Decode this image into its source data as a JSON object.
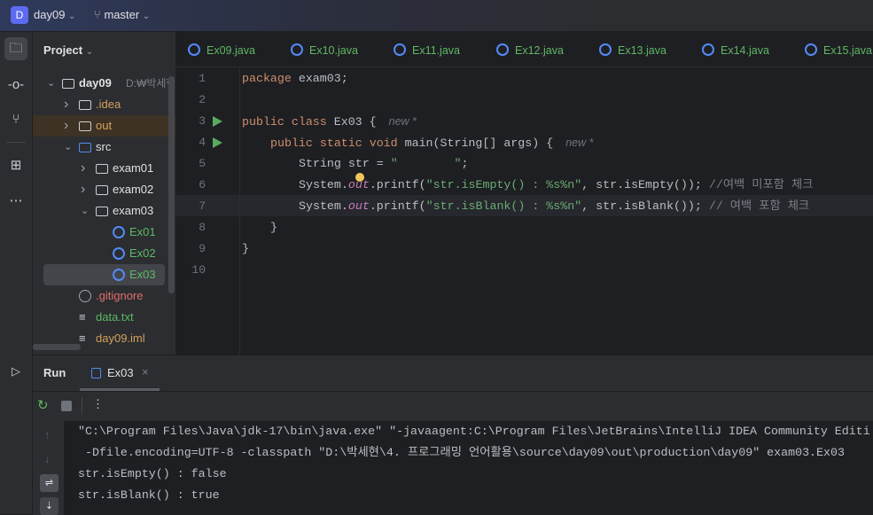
{
  "topbar": {
    "project_badge": "D",
    "project": "day09",
    "branch": "master"
  },
  "project_panel": {
    "title": "Project",
    "tree": [
      {
        "label": "day09",
        "path": "D:₩박세현",
        "kind": "module"
      },
      {
        "label": ".idea",
        "kind": "folder"
      },
      {
        "label": "out",
        "kind": "folder-excluded"
      },
      {
        "label": "src",
        "kind": "source"
      },
      {
        "label": "exam01",
        "kind": "package"
      },
      {
        "label": "exam02",
        "kind": "package"
      },
      {
        "label": "exam03",
        "kind": "package"
      },
      {
        "label": "Ex01",
        "kind": "class"
      },
      {
        "label": "Ex02",
        "kind": "class"
      },
      {
        "label": "Ex03",
        "kind": "class",
        "selected": true
      },
      {
        "label": ".gitignore",
        "kind": "ignore"
      },
      {
        "label": "data.txt",
        "kind": "text"
      },
      {
        "label": "day09.iml",
        "kind": "iml"
      }
    ]
  },
  "tabs": [
    "Ex09.java",
    "Ex10.java",
    "Ex11.java",
    "Ex12.java",
    "Ex13.java",
    "Ex14.java",
    "Ex15.java"
  ],
  "editor": {
    "line_numbers": [
      "1",
      "2",
      "3",
      "4",
      "5",
      "6",
      "7",
      "8",
      "9",
      "10"
    ],
    "l1a": "package",
    "l1b": " exam03;",
    "l3a": "public class",
    "l3b": " Ex03 {",
    "l3hint": "new *",
    "l4a": "public static void",
    "l4b": " main(String[] args) {",
    "l4hint": "new *",
    "l5a": "String str = ",
    "l5b": "\"        \"",
    "l5c": ";",
    "l6a": "System.",
    "l6b": "out",
    "l6c": ".printf(",
    "l6d": "\"str.isEmpty() : %s%n\"",
    "l6e": ", str.isEmpty()); ",
    "l6f": "//여백 미포함 체크",
    "l7a": "System.",
    "l7b": "out",
    "l7c": ".printf(",
    "l7d": "\"str.isBlank() : %s%n\"",
    "l7e": ", str.isBlank()); ",
    "l7f": "// 여백 포함 체크",
    "l8": "}",
    "l9": "}"
  },
  "run": {
    "title": "Run",
    "tab": "Ex03",
    "output": [
      "\"C:\\Program Files\\Java\\jdk-17\\bin\\java.exe\" \"-javaagent:C:\\Program Files\\JetBrains\\IntelliJ IDEA Community Editi",
      " -Dfile.encoding=UTF-8 -classpath \"D:\\박세현\\4. 프로그래밍 언어활용\\source\\day09\\out\\production\\day09\" exam03.Ex03",
      "str.isEmpty() : false",
      "str.isBlank() : true"
    ]
  }
}
